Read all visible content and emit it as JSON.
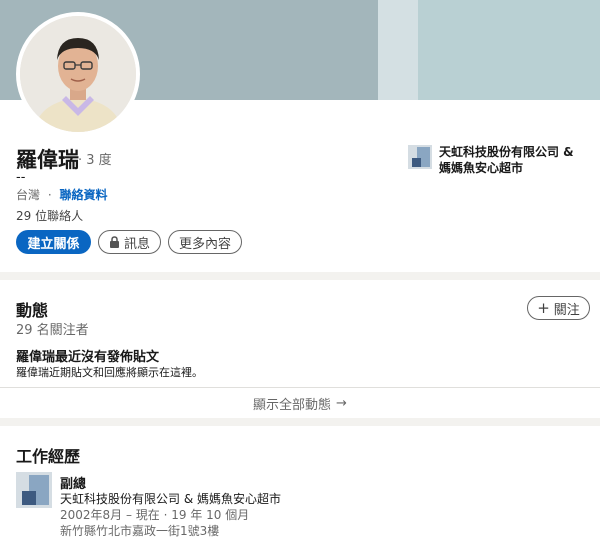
{
  "profile": {
    "name": "羅偉瑞",
    "degree": "· 3 度",
    "headline": "--",
    "location": "台灣",
    "separator": "·",
    "contact_info": "聯絡資料",
    "connections": "29 位聯絡人",
    "buttons": {
      "connect": "建立關係",
      "message": "訊息",
      "more": "更多內容"
    },
    "current_company": "天虹科技股份有限公司 & 媽媽魚安心超市"
  },
  "activity": {
    "title": "動態",
    "followers": "29 名關注者",
    "follow_label": "關注",
    "no_posts_title": "羅偉瑞最近沒有發佈貼文",
    "no_posts_desc": "羅偉瑞近期貼文和回應將顯示在這裡。",
    "show_all": "顯示全部動態"
  },
  "experience": {
    "title": "工作經歷",
    "items": [
      {
        "title": "副總",
        "company": "天虹科技股份有限公司 & 媽媽魚安心超市",
        "dates": "2002年8月 – 現在 · 19 年 10 個月",
        "location": "新竹縣竹北市嘉政一街1號3樓"
      }
    ]
  },
  "colors": {
    "primary": "#0a66c2",
    "banner": "#a3b6bb",
    "page_bg": "#f3f2ef"
  }
}
